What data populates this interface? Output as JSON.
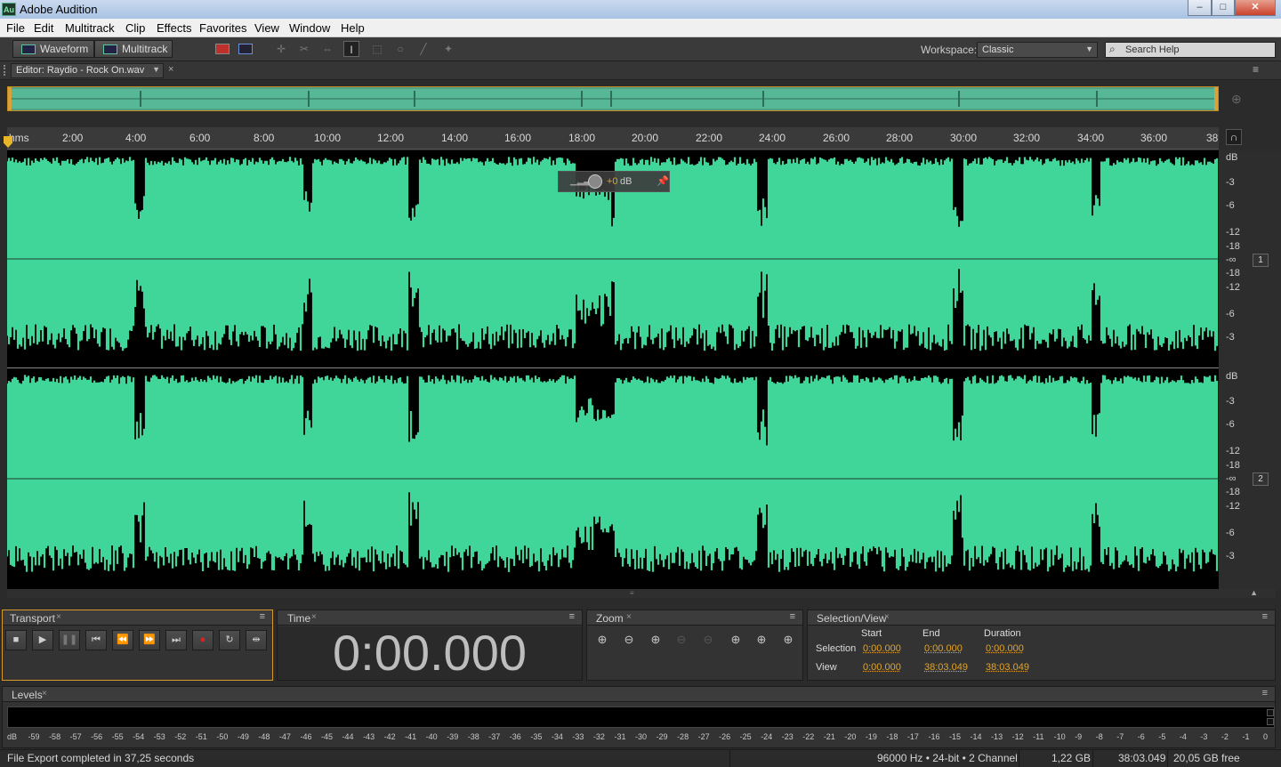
{
  "window": {
    "title": "Adobe Audition",
    "logo": "Au",
    "minimize": "–",
    "maximize": "□",
    "close": "✕"
  },
  "menu": [
    "File",
    "Edit",
    "Multitrack",
    "Clip",
    "Effects",
    "Favorites",
    "View",
    "Window",
    "Help"
  ],
  "toolbar": {
    "waveform_label": "Waveform",
    "multitrack_label": "Multitrack",
    "workspace_label": "Workspace:",
    "workspace_value": "Classic",
    "search_placeholder": "Search Help"
  },
  "editor": {
    "tab_label": "Editor: Raydio - Rock On.wav",
    "close": "×",
    "menu_icon": "≡"
  },
  "ruler": {
    "unit": "hms",
    "ticks": [
      "2:00",
      "4:00",
      "6:00",
      "8:00",
      "10:00",
      "12:00",
      "14:00",
      "16:00",
      "18:00",
      "20:00",
      "22:00",
      "24:00",
      "26:00",
      "28:00",
      "30:00",
      "32:00",
      "34:00",
      "36:00",
      "38"
    ]
  },
  "hud": {
    "value": "+0",
    "unit": "dB"
  },
  "db_scale": {
    "header": "dB",
    "labels": [
      "-3",
      "-6",
      "-12",
      "-18",
      "-∞",
      "-18",
      "-12",
      "-6",
      "-3"
    ]
  },
  "channels": [
    "1",
    "2"
  ],
  "transport": {
    "title": "Transport"
  },
  "time": {
    "title": "Time",
    "display": "0:00.000"
  },
  "zoom": {
    "title": "Zoom"
  },
  "selection_view": {
    "title": "Selection/View",
    "col_start": "Start",
    "col_end": "End",
    "col_duration": "Duration",
    "row_selection": "Selection",
    "row_view": "View",
    "selection": {
      "start": "0:00.000",
      "end": "0:00.000",
      "duration": "0:00.000"
    },
    "view": {
      "start": "0:00.000",
      "end": "38:03.049",
      "duration": "38:03.049"
    }
  },
  "levels": {
    "title": "Levels",
    "scale": [
      "dB",
      "-59",
      "-58",
      "-57",
      "-56",
      "-55",
      "-54",
      "-53",
      "-52",
      "-51",
      "-50",
      "-49",
      "-48",
      "-47",
      "-46",
      "-45",
      "-44",
      "-43",
      "-42",
      "-41",
      "-40",
      "-39",
      "-38",
      "-37",
      "-36",
      "-35",
      "-34",
      "-33",
      "-32",
      "-31",
      "-30",
      "-29",
      "-28",
      "-27",
      "-26",
      "-25",
      "-24",
      "-23",
      "-22",
      "-21",
      "-20",
      "-19",
      "-18",
      "-17",
      "-16",
      "-15",
      "-14",
      "-13",
      "-12",
      "-11",
      "-10",
      "-9",
      "-8",
      "-7",
      "-6",
      "-5",
      "-4",
      "-3",
      "-2",
      "-1",
      "0"
    ]
  },
  "status": {
    "message": "File Export completed in 37,25 seconds",
    "format": "96000 Hz • 24-bit • 2 Channel",
    "size": "1,22 GB",
    "duration": "38:03.049",
    "free": "20,05 GB free"
  },
  "colors": {
    "waveform": "#40d69a",
    "accent": "#e2a329",
    "background": "#2b2b2b"
  }
}
